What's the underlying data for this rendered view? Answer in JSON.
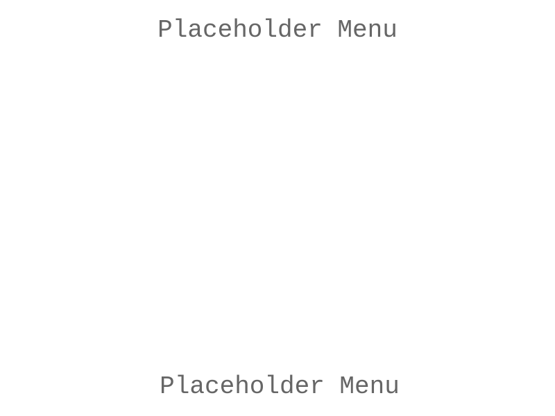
{
  "top_menu": {
    "label": "Placeholder Menu"
  },
  "bottom_menu": {
    "label": "Placeholder Menu"
  },
  "colors": {
    "background": "#ffffff",
    "text": "#666666"
  }
}
